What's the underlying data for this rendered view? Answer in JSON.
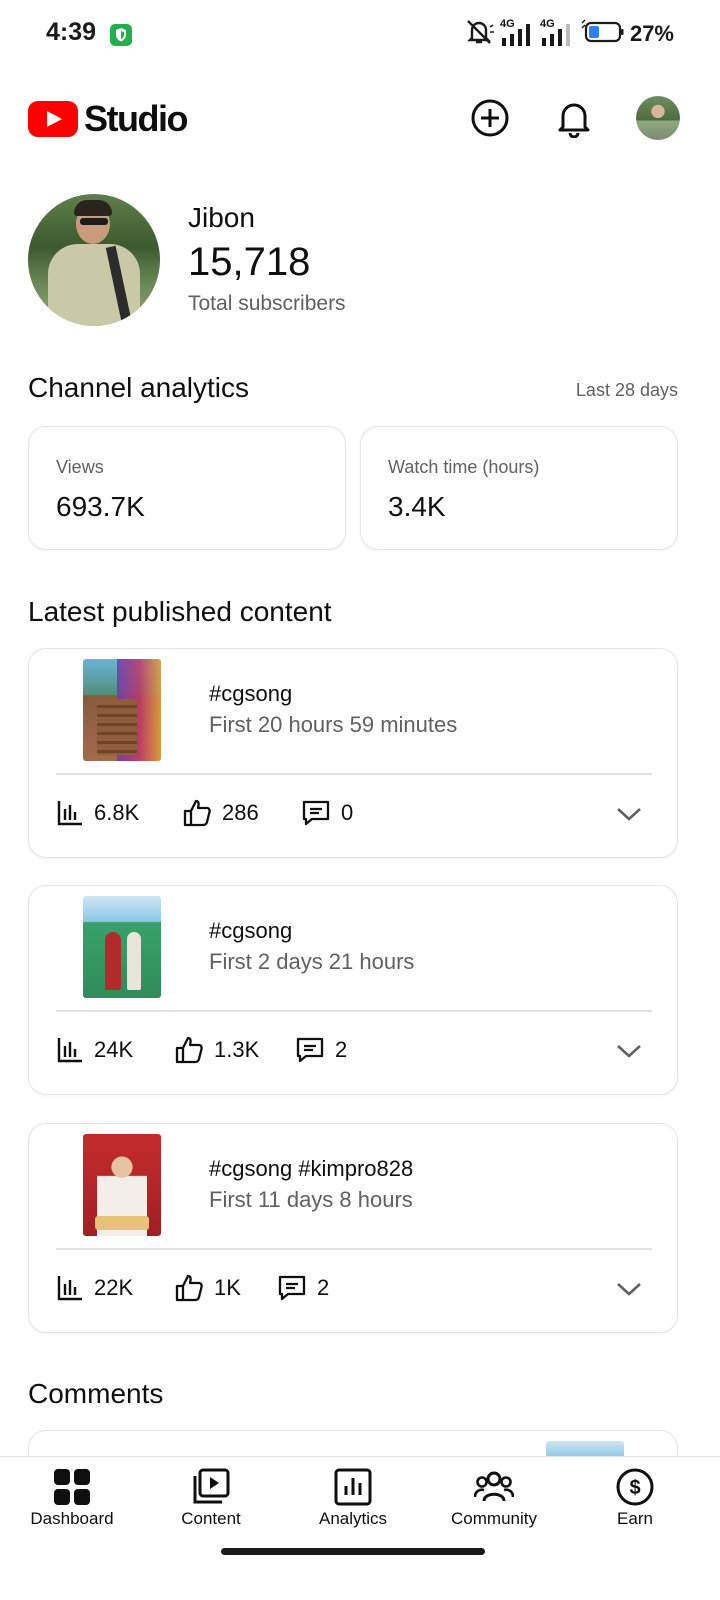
{
  "status_bar": {
    "time": "4:39",
    "battery": "27%",
    "network_1": "4G",
    "network_2": "4G"
  },
  "header": {
    "logo_text": "Studio"
  },
  "profile": {
    "name": "Jibon",
    "subscribers": "15,718",
    "subscribers_label": "Total subscribers"
  },
  "analytics": {
    "title": "Channel analytics",
    "range": "Last 28 days",
    "metrics": [
      {
        "label": "Views",
        "value": "693.7K"
      },
      {
        "label": "Watch time (hours)",
        "value": "3.4K"
      }
    ]
  },
  "latest": {
    "title": "Latest published content",
    "items": [
      {
        "title": "#cgsong",
        "subtitle": "First 20 hours 59 minutes",
        "views": "6.8K",
        "likes": "286",
        "comments": "0"
      },
      {
        "title": "#cgsong",
        "subtitle": "First 2 days 21 hours",
        "views": "24K",
        "likes": "1.3K",
        "comments": "2"
      },
      {
        "title": "#cgsong #kimpro828",
        "subtitle": "First 11 days 8 hours",
        "views": "22K",
        "likes": "1K",
        "comments": "2"
      }
    ]
  },
  "comments": {
    "title": "Comments"
  },
  "bottom_nav": {
    "items": [
      {
        "label": "Dashboard",
        "icon": "dashboard-icon",
        "active": true
      },
      {
        "label": "Content",
        "icon": "content-icon"
      },
      {
        "label": "Analytics",
        "icon": "analytics-icon"
      },
      {
        "label": "Community",
        "icon": "community-icon"
      },
      {
        "label": "Earn",
        "icon": "earn-icon"
      }
    ]
  },
  "colors": {
    "brand_red": "#ff0000",
    "text_primary": "#0f0f0f",
    "text_secondary": "#606060",
    "card_border": "#e5e5e5",
    "shield_green": "#21b04b"
  }
}
